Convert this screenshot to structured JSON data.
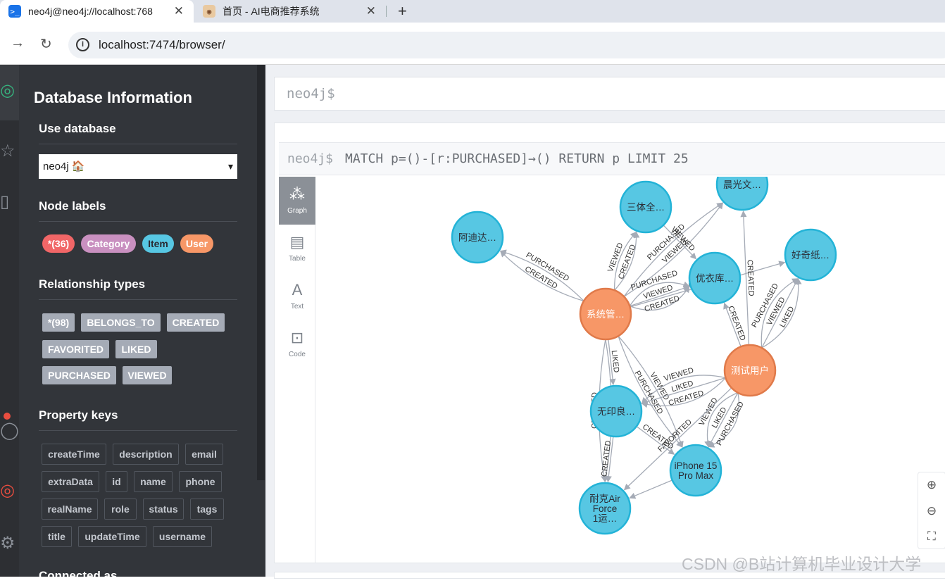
{
  "browser": {
    "tabs": [
      {
        "title": "neo4j@neo4j://localhost:768",
        "active": true
      },
      {
        "title": "首页 - AI电商推荐系统",
        "active": false
      }
    ],
    "url": "localhost:7474/browser/"
  },
  "sidebar": {
    "title": "Database Information",
    "use_database_label": "Use database",
    "database": "neo4j 🏠",
    "node_labels_title": "Node labels",
    "node_labels": [
      {
        "label": "*(36)",
        "color": "#f16667"
      },
      {
        "label": "Category",
        "color": "#c990c0"
      },
      {
        "label": "Item",
        "color": "#57c7e3"
      },
      {
        "label": "User",
        "color": "#f79767"
      }
    ],
    "relationship_types_title": "Relationship types",
    "relationship_types": [
      "*(98)",
      "BELONGS_TO",
      "CREATED",
      "FAVORITED",
      "LIKED",
      "PURCHASED",
      "VIEWED"
    ],
    "property_keys_title": "Property keys",
    "property_keys": [
      "createTime",
      "description",
      "email",
      "extraData",
      "id",
      "name",
      "phone",
      "realName",
      "role",
      "status",
      "tags",
      "title",
      "updateTime",
      "username"
    ],
    "connected_as": "Connected as"
  },
  "editor": {
    "prompt": "neo4j$"
  },
  "frame": {
    "prompt": "neo4j$",
    "query": "MATCH p=()-[r:PURCHASED]→() RETURN p LIMIT 25",
    "views": [
      "Graph",
      "Table",
      "Text",
      "Code"
    ],
    "active_view": "Graph"
  },
  "graph": {
    "nodes": [
      {
        "id": "sys",
        "caption": "系统管…",
        "type": "User"
      },
      {
        "id": "test",
        "caption": "测试用户",
        "type": "User"
      },
      {
        "id": "adidas",
        "caption": "阿迪达…",
        "type": "Item"
      },
      {
        "id": "santi",
        "caption": "三体全…",
        "type": "Item"
      },
      {
        "id": "chenguang",
        "caption": "晨光文…",
        "type": "Item"
      },
      {
        "id": "uniqlo",
        "caption": "优衣库…",
        "type": "Item"
      },
      {
        "id": "haoqi",
        "caption": "好奇纸…",
        "type": "Item"
      },
      {
        "id": "muji",
        "caption": "无印良…",
        "type": "Item"
      },
      {
        "id": "iphone",
        "caption": "iPhone 15 Pro Max",
        "type": "Item"
      },
      {
        "id": "nike",
        "caption": "耐克Air Force 1运…",
        "type": "Item"
      }
    ],
    "edges": [
      {
        "from": "sys",
        "to": "adidas",
        "label": "CREATED"
      },
      {
        "from": "sys",
        "to": "adidas",
        "label": "PURCHASED"
      },
      {
        "from": "sys",
        "to": "santi",
        "label": "VIEWED"
      },
      {
        "from": "sys",
        "to": "santi",
        "label": "CREATED"
      },
      {
        "from": "sys",
        "to": "chenguang",
        "label": "PURCHASED"
      },
      {
        "from": "sys",
        "to": "chenguang",
        "label": "VIEWED"
      },
      {
        "from": "sys",
        "to": "uniqlo",
        "label": "PURCHASED"
      },
      {
        "from": "sys",
        "to": "uniqlo",
        "label": "VIEWED"
      },
      {
        "from": "sys",
        "to": "uniqlo",
        "label": "CREATED"
      },
      {
        "from": "sys",
        "to": "haoqi",
        "label": "CREATED"
      },
      {
        "from": "sys",
        "to": "muji",
        "label": "LIKED"
      },
      {
        "from": "sys",
        "to": "iphone",
        "label": "VIEWED"
      },
      {
        "from": "sys",
        "to": "iphone",
        "label": "PURCHASED"
      },
      {
        "from": "sys",
        "to": "nike",
        "label": "CREATED"
      },
      {
        "from": "sys",
        "to": "nike",
        "label": "CREATED"
      },
      {
        "from": "santi",
        "to": "uniqlo",
        "label": "VIEWED"
      },
      {
        "from": "test",
        "to": "chenguang",
        "label": "CREATED"
      },
      {
        "from": "test",
        "to": "uniqlo",
        "label": "CREATED"
      },
      {
        "from": "test",
        "to": "haoqi",
        "label": "PURCHASED"
      },
      {
        "from": "test",
        "to": "haoqi",
        "label": "VIEWED"
      },
      {
        "from": "test",
        "to": "haoqi",
        "label": "LIKED"
      },
      {
        "from": "test",
        "to": "muji",
        "label": "CREATED"
      },
      {
        "from": "test",
        "to": "muji",
        "label": "LIKED"
      },
      {
        "from": "test",
        "to": "muji",
        "label": "VIEWED"
      },
      {
        "from": "test",
        "to": "iphone",
        "label": "PURCHASED"
      },
      {
        "from": "test",
        "to": "iphone",
        "label": "LIKED"
      },
      {
        "from": "test",
        "to": "iphone",
        "label": "VIEWED"
      },
      {
        "from": "test",
        "to": "nike",
        "label": "FAVORITED"
      },
      {
        "from": "muji",
        "to": "iphone",
        "label": "CREATED"
      },
      {
        "from": "muji",
        "to": "nike",
        "label": "CREATED"
      },
      {
        "from": "iphone",
        "to": "nike",
        "label": ""
      }
    ]
  },
  "watermark": "CSDN @B站计算机毕业设计大学",
  "colors": {
    "user": "#f79767",
    "user_border": "#e07a4a",
    "item": "#57c7e3",
    "item_border": "#23b3d7",
    "edge": "#a5abb6"
  }
}
